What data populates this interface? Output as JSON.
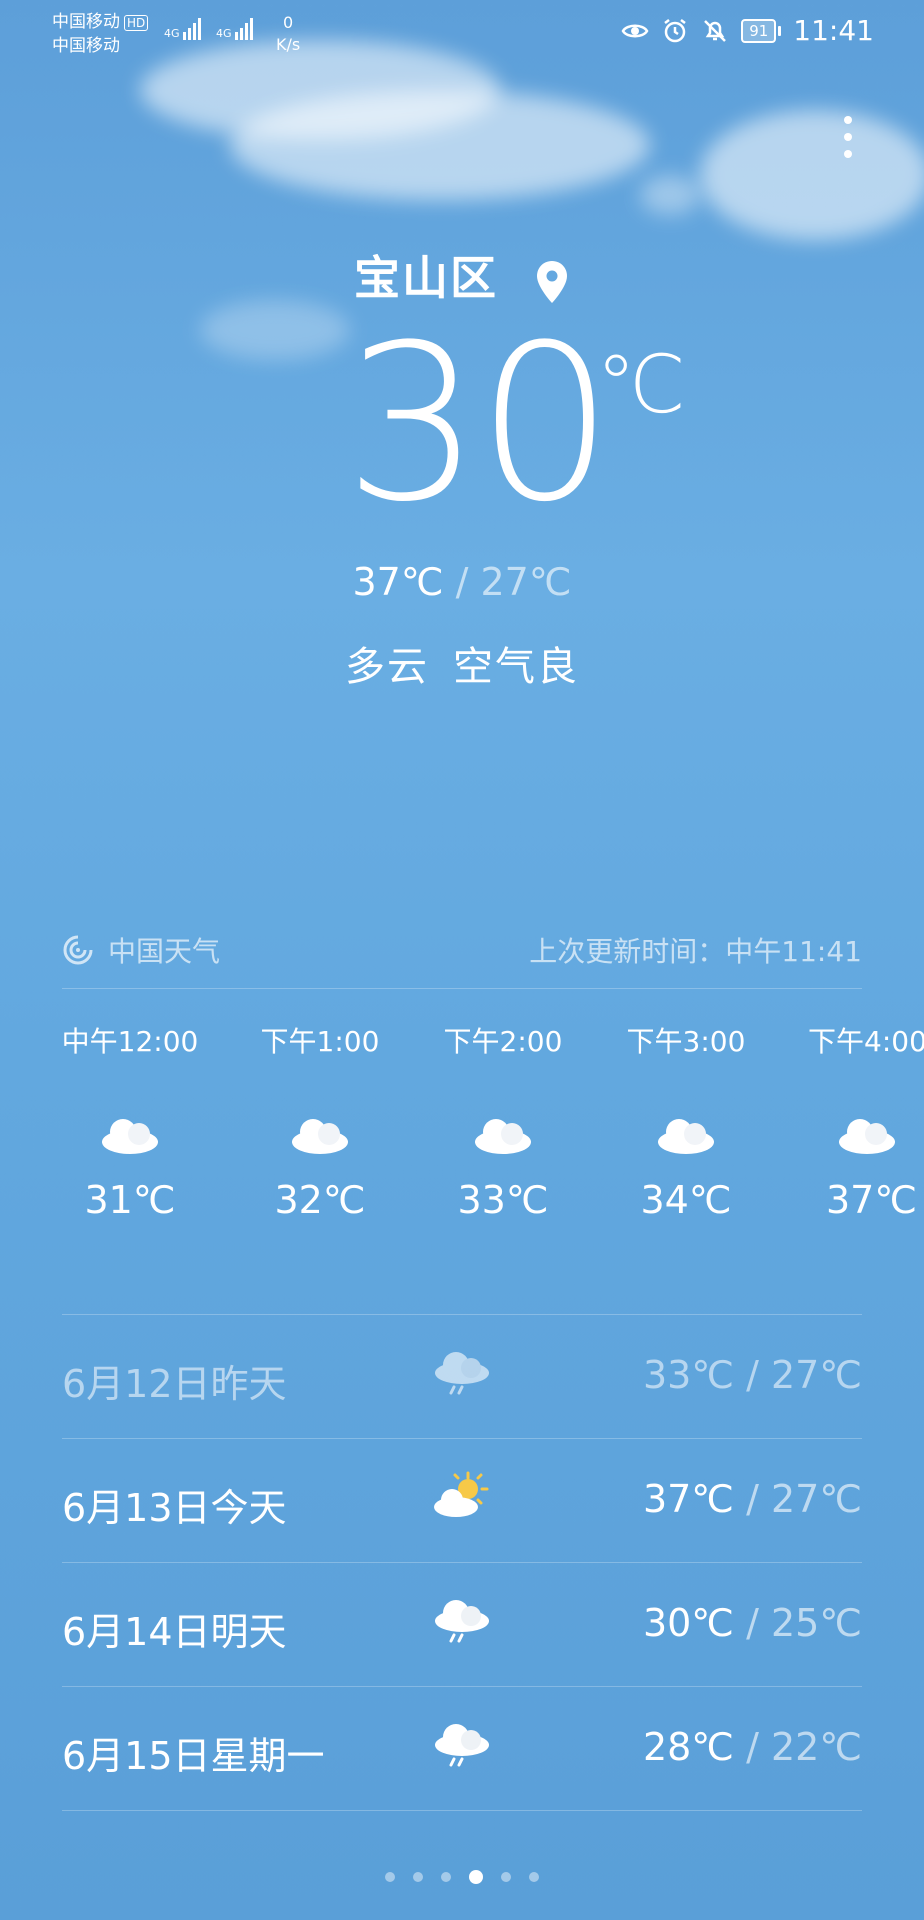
{
  "status_bar": {
    "carrier1": "中国移动",
    "carrier1_badge": "HD",
    "carrier2": "中国移动",
    "network1": "4G",
    "network2": "4G",
    "speed_value": "0",
    "speed_unit": "K/s",
    "battery": "91",
    "time": "11:41"
  },
  "location": "宝山区",
  "current": {
    "temp": "30",
    "unit": "℃",
    "high": "37℃",
    "separator": "/",
    "low": "27℃",
    "condition": "多云",
    "air": "空气良"
  },
  "source": {
    "name": "中国天气",
    "updated": "上次更新时间：中午11:41"
  },
  "hourly": [
    {
      "time": "中午12:00",
      "icon": "cloudy-icon",
      "temp": "31℃"
    },
    {
      "time": "下午1:00",
      "icon": "cloudy-icon",
      "temp": "32℃"
    },
    {
      "time": "下午2:00",
      "icon": "cloudy-icon",
      "temp": "33℃"
    },
    {
      "time": "下午3:00",
      "icon": "cloudy-icon",
      "temp": "34℃"
    },
    {
      "time": "下午4:00",
      "icon": "cloudy-icon",
      "temp": "37℃"
    }
  ],
  "daily": [
    {
      "date": "6月12日昨天",
      "icon": "rain-icon",
      "high": "33℃",
      "low": "27℃"
    },
    {
      "date": "6月13日今天",
      "icon": "partly-sunny-icon",
      "high": "37℃",
      "low": "27℃"
    },
    {
      "date": "6月14日明天",
      "icon": "rain-icon",
      "high": "30℃",
      "low": "25℃"
    },
    {
      "date": "6月15日星期一",
      "icon": "rain-icon",
      "high": "28℃",
      "low": "22℃"
    }
  ],
  "pager": {
    "count": 6,
    "active_index": 3
  }
}
